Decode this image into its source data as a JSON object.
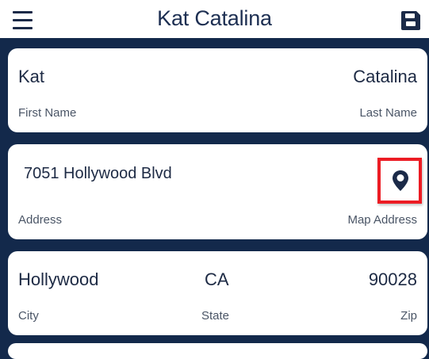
{
  "header": {
    "title": "Kat Catalina",
    "menu_icon": "hamburger-menu-icon",
    "save_icon": "floppy-disk-save-icon"
  },
  "name_card": {
    "first_name": "Kat",
    "last_name": "Catalina",
    "first_name_label": "First Name",
    "last_name_label": "Last Name"
  },
  "address_card": {
    "address": "7051 Hollywood Blvd",
    "address_label": "Address",
    "map_label": "Map Address",
    "map_icon": "map-pin-icon"
  },
  "location_card": {
    "city": "Hollywood",
    "state": "CA",
    "zip": "90028",
    "city_label": "City",
    "state_label": "State",
    "zip_label": "Zip"
  },
  "colors": {
    "background": "#13294b",
    "card": "#ffffff",
    "text": "#1d2a44",
    "label": "#4a5566",
    "highlight": "#ec1c24"
  }
}
